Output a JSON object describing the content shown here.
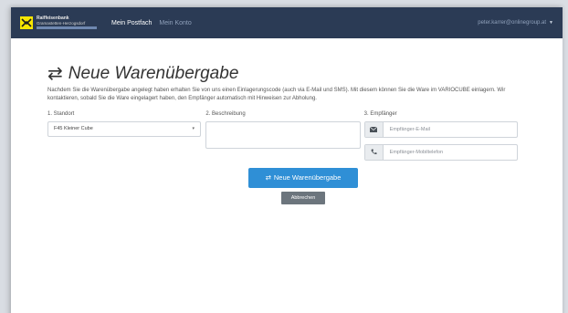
{
  "navbar": {
    "brand_line1": "Raiffeisenbank",
    "brand_line2": "Gramastetten-Herzogsdorf",
    "brand_bar": "",
    "links": [
      {
        "label": "Mein Postfach",
        "active": true
      },
      {
        "label": "Mein Konto",
        "active": false
      }
    ],
    "user_email": "peter.karrer@onlinegroup.at",
    "colors": {
      "background": "#2b3b55",
      "logo": "#f7e600"
    }
  },
  "page": {
    "title": "Neue Warenübergabe",
    "title_icon": "exchange-arrows-icon",
    "intro": "Nachdem Sie die Warenübergabe angelegt haben erhalten Sie von uns einen Einlagerungscode (auch via E-Mail und SMS). Mit diesem können Sie die Ware im VARIOCUBE einlagern. Wir kontaktieren, sobald Sie die Ware eingelagert haben, den Empfänger automatisch mit Hinweisen zur Abholung."
  },
  "form": {
    "standort": {
      "label": "1. Standort",
      "selected": "F45 Kleiner Cube"
    },
    "beschreibung": {
      "label": "2. Beschreibung",
      "value": ""
    },
    "empfaenger": {
      "label": "3. Empfänger",
      "email_placeholder": "Empfänger-E-Mail",
      "email_icon": "envelope-icon",
      "phone_placeholder": "Empfänger-Mobiltelefon",
      "phone_icon": "phone-icon"
    }
  },
  "actions": {
    "submit_label": "Neue Warenübergabe",
    "submit_icon": "exchange-arrows-icon",
    "cancel_label": "Abbrechen",
    "primary_color": "#2f8fd6",
    "secondary_color": "#6c757d"
  }
}
